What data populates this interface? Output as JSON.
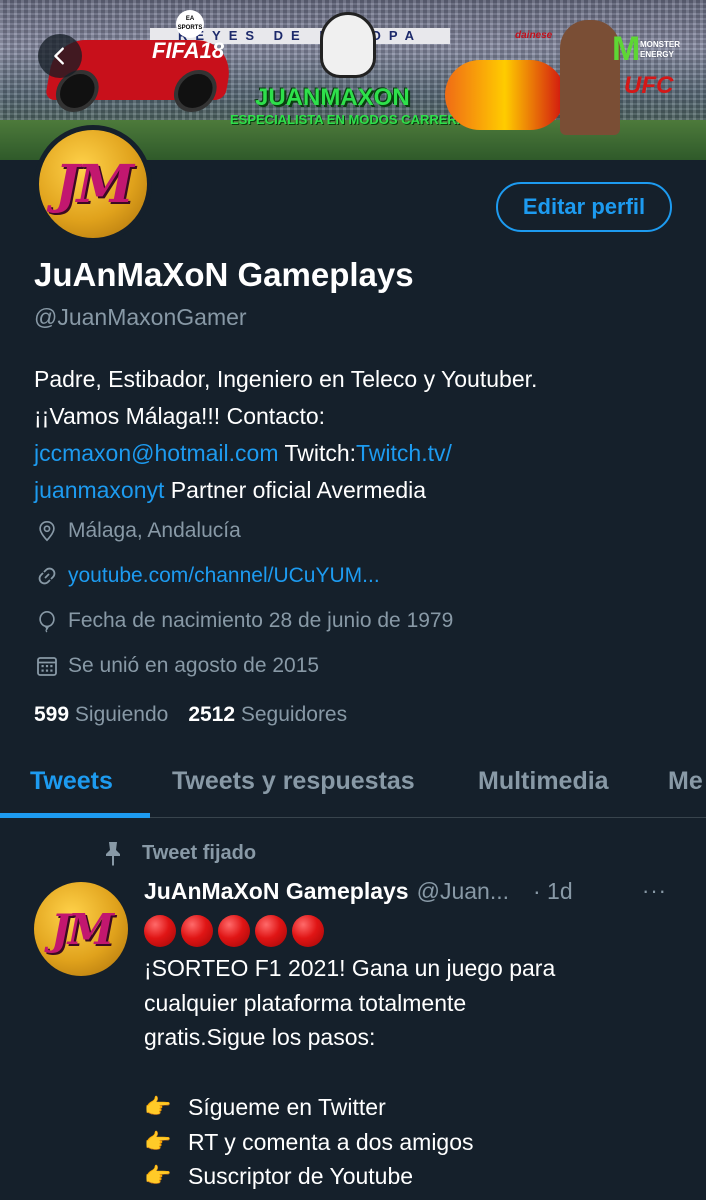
{
  "banner": {
    "sign_text": "REYES DE EUROPA",
    "fifa_text": "FIFA18",
    "ea_text": "EA SPORTS",
    "brand_text": "JUANMAXON",
    "tagline_text": "ESPECIALISTA EN MODOS CARRERA",
    "dainese_text": "dainese",
    "monster_text": "MONSTER ENERGY",
    "ufc_text": "UFC"
  },
  "profile": {
    "avatar_text": "JM",
    "name": "JuAnMaXoN Gameplays",
    "handle": "@JuanMaxonGamer",
    "edit_label": "Editar perfil",
    "bio_line1": "Padre, Estibador, Ingeniero en Teleco y Youtuber.",
    "bio_line2": "¡¡Vamos Málaga!!! Contacto:",
    "bio_email": "jccmaxon@hotmail.com",
    "bio_twitch_prefix": " Twitch:",
    "bio_twitch_link1": "Twitch.tv/",
    "bio_twitch_link2": "juanmaxonyt",
    "bio_partner": " Partner oficial Avermedia",
    "location": "Málaga, Andalucía",
    "url": "youtube.com/channel/UCuYUM...",
    "birthday": "Fecha de nacimiento 28 de junio de 1979",
    "joined": "Se unió en agosto de 2015",
    "following_count": "599",
    "following_label": "Siguiendo",
    "followers_count": "2512",
    "followers_label": "Seguidores"
  },
  "tabs": [
    {
      "label": "Tweets",
      "active": true
    },
    {
      "label": "Tweets y respuestas",
      "active": false
    },
    {
      "label": "Multimedia",
      "active": false
    },
    {
      "label": "Me",
      "active": false
    }
  ],
  "tweet": {
    "pinned_label": "Tweet fijado",
    "author_name": "JuAnMaXoN Gameplays",
    "author_handle": "@Juan...",
    "time": "· 1d",
    "more": "···",
    "emoji_count": 5,
    "text_line1": "¡SORTEO F1 2021! Gana un juego para",
    "text_line2": "cualquier plataforma totalmente",
    "text_line3": "gratis.Sigue los pasos:",
    "steps": [
      "Sígueme en Twitter",
      "RT y comenta a dos amigos",
      "Suscriptor de Youtube"
    ]
  },
  "colors": {
    "background": "#15202b",
    "accent": "#1d9bf0",
    "secondary_text": "#8899a6"
  },
  "icons": {
    "back": "back-arrow-icon",
    "location": "location-pin-icon",
    "link": "link-icon",
    "birthday": "balloon-icon",
    "calendar": "calendar-icon",
    "pin": "pin-icon",
    "pointing_hand": "backhand-index-pointing-right-icon"
  }
}
